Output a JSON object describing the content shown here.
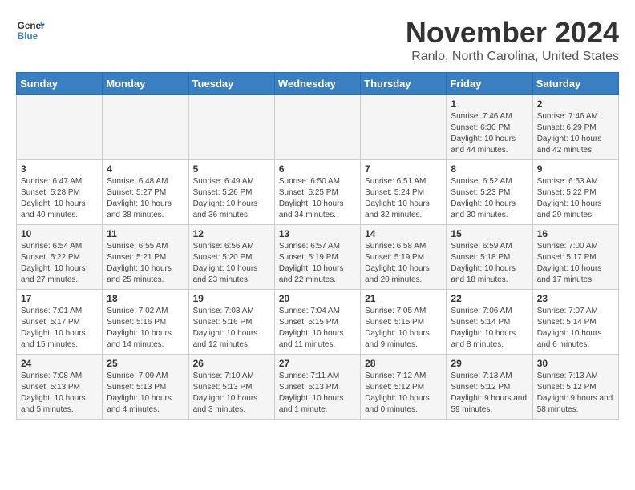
{
  "logo": {
    "line1": "General",
    "line2": "Blue"
  },
  "title": "November 2024",
  "subtitle": "Ranlo, North Carolina, United States",
  "days_of_week": [
    "Sunday",
    "Monday",
    "Tuesday",
    "Wednesday",
    "Thursday",
    "Friday",
    "Saturday"
  ],
  "weeks": [
    [
      {
        "day": "",
        "info": ""
      },
      {
        "day": "",
        "info": ""
      },
      {
        "day": "",
        "info": ""
      },
      {
        "day": "",
        "info": ""
      },
      {
        "day": "",
        "info": ""
      },
      {
        "day": "1",
        "info": "Sunrise: 7:46 AM\nSunset: 6:30 PM\nDaylight: 10 hours and 44 minutes."
      },
      {
        "day": "2",
        "info": "Sunrise: 7:46 AM\nSunset: 6:29 PM\nDaylight: 10 hours and 42 minutes."
      }
    ],
    [
      {
        "day": "3",
        "info": "Sunrise: 6:47 AM\nSunset: 5:28 PM\nDaylight: 10 hours and 40 minutes."
      },
      {
        "day": "4",
        "info": "Sunrise: 6:48 AM\nSunset: 5:27 PM\nDaylight: 10 hours and 38 minutes."
      },
      {
        "day": "5",
        "info": "Sunrise: 6:49 AM\nSunset: 5:26 PM\nDaylight: 10 hours and 36 minutes."
      },
      {
        "day": "6",
        "info": "Sunrise: 6:50 AM\nSunset: 5:25 PM\nDaylight: 10 hours and 34 minutes."
      },
      {
        "day": "7",
        "info": "Sunrise: 6:51 AM\nSunset: 5:24 PM\nDaylight: 10 hours and 32 minutes."
      },
      {
        "day": "8",
        "info": "Sunrise: 6:52 AM\nSunset: 5:23 PM\nDaylight: 10 hours and 30 minutes."
      },
      {
        "day": "9",
        "info": "Sunrise: 6:53 AM\nSunset: 5:22 PM\nDaylight: 10 hours and 29 minutes."
      }
    ],
    [
      {
        "day": "10",
        "info": "Sunrise: 6:54 AM\nSunset: 5:22 PM\nDaylight: 10 hours and 27 minutes."
      },
      {
        "day": "11",
        "info": "Sunrise: 6:55 AM\nSunset: 5:21 PM\nDaylight: 10 hours and 25 minutes."
      },
      {
        "day": "12",
        "info": "Sunrise: 6:56 AM\nSunset: 5:20 PM\nDaylight: 10 hours and 23 minutes."
      },
      {
        "day": "13",
        "info": "Sunrise: 6:57 AM\nSunset: 5:19 PM\nDaylight: 10 hours and 22 minutes."
      },
      {
        "day": "14",
        "info": "Sunrise: 6:58 AM\nSunset: 5:19 PM\nDaylight: 10 hours and 20 minutes."
      },
      {
        "day": "15",
        "info": "Sunrise: 6:59 AM\nSunset: 5:18 PM\nDaylight: 10 hours and 18 minutes."
      },
      {
        "day": "16",
        "info": "Sunrise: 7:00 AM\nSunset: 5:17 PM\nDaylight: 10 hours and 17 minutes."
      }
    ],
    [
      {
        "day": "17",
        "info": "Sunrise: 7:01 AM\nSunset: 5:17 PM\nDaylight: 10 hours and 15 minutes."
      },
      {
        "day": "18",
        "info": "Sunrise: 7:02 AM\nSunset: 5:16 PM\nDaylight: 10 hours and 14 minutes."
      },
      {
        "day": "19",
        "info": "Sunrise: 7:03 AM\nSunset: 5:16 PM\nDaylight: 10 hours and 12 minutes."
      },
      {
        "day": "20",
        "info": "Sunrise: 7:04 AM\nSunset: 5:15 PM\nDaylight: 10 hours and 11 minutes."
      },
      {
        "day": "21",
        "info": "Sunrise: 7:05 AM\nSunset: 5:15 PM\nDaylight: 10 hours and 9 minutes."
      },
      {
        "day": "22",
        "info": "Sunrise: 7:06 AM\nSunset: 5:14 PM\nDaylight: 10 hours and 8 minutes."
      },
      {
        "day": "23",
        "info": "Sunrise: 7:07 AM\nSunset: 5:14 PM\nDaylight: 10 hours and 6 minutes."
      }
    ],
    [
      {
        "day": "24",
        "info": "Sunrise: 7:08 AM\nSunset: 5:13 PM\nDaylight: 10 hours and 5 minutes."
      },
      {
        "day": "25",
        "info": "Sunrise: 7:09 AM\nSunset: 5:13 PM\nDaylight: 10 hours and 4 minutes."
      },
      {
        "day": "26",
        "info": "Sunrise: 7:10 AM\nSunset: 5:13 PM\nDaylight: 10 hours and 3 minutes."
      },
      {
        "day": "27",
        "info": "Sunrise: 7:11 AM\nSunset: 5:13 PM\nDaylight: 10 hours and 1 minute."
      },
      {
        "day": "28",
        "info": "Sunrise: 7:12 AM\nSunset: 5:12 PM\nDaylight: 10 hours and 0 minutes."
      },
      {
        "day": "29",
        "info": "Sunrise: 7:13 AM\nSunset: 5:12 PM\nDaylight: 9 hours and 59 minutes."
      },
      {
        "day": "30",
        "info": "Sunrise: 7:13 AM\nSunset: 5:12 PM\nDaylight: 9 hours and 58 minutes."
      }
    ]
  ]
}
